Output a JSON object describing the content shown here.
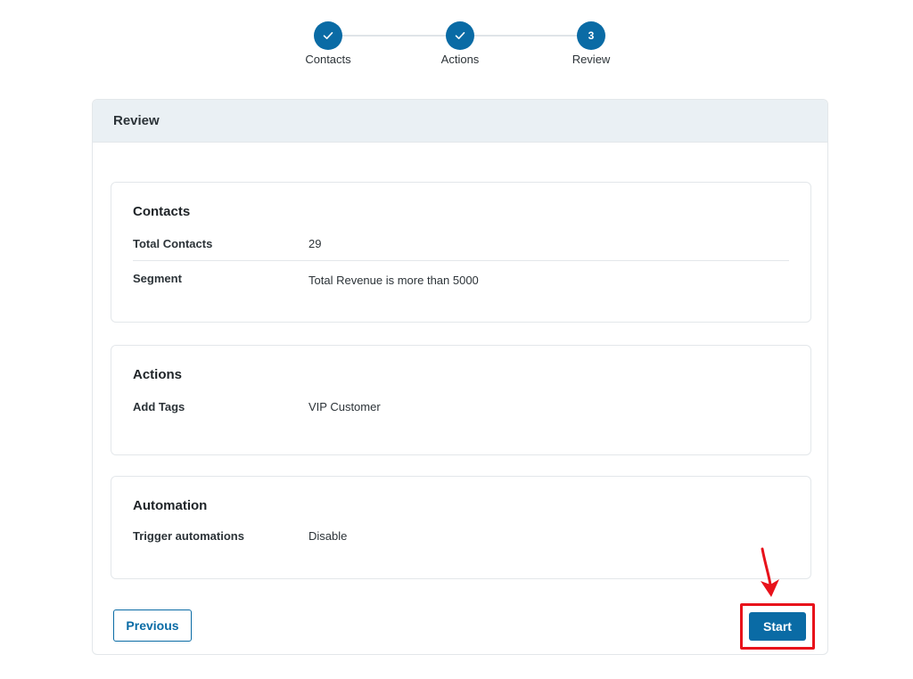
{
  "stepper": {
    "steps": [
      {
        "label": "Contacts",
        "status": "complete",
        "icon": "check-icon"
      },
      {
        "label": "Actions",
        "status": "complete",
        "icon": "check-icon"
      },
      {
        "label": "Review",
        "status": "current",
        "number": "3"
      }
    ]
  },
  "card": {
    "title": "Review",
    "sections": {
      "contacts": {
        "title": "Contacts",
        "rows": [
          {
            "label": "Total Contacts",
            "value": "29"
          },
          {
            "label": "Segment",
            "value": "Total Revenue is more than 5000"
          }
        ]
      },
      "actions": {
        "title": "Actions",
        "rows": [
          {
            "label": "Add Tags",
            "value": "VIP Customer"
          }
        ]
      },
      "automation": {
        "title": "Automation",
        "rows": [
          {
            "label": "Trigger automations",
            "value": "Disable"
          }
        ]
      }
    }
  },
  "footer": {
    "previous_label": "Previous",
    "start_label": "Start"
  },
  "colors": {
    "primary": "#0a6ba5",
    "highlight": "#e8121b",
    "header_bg": "#eaf0f4"
  }
}
